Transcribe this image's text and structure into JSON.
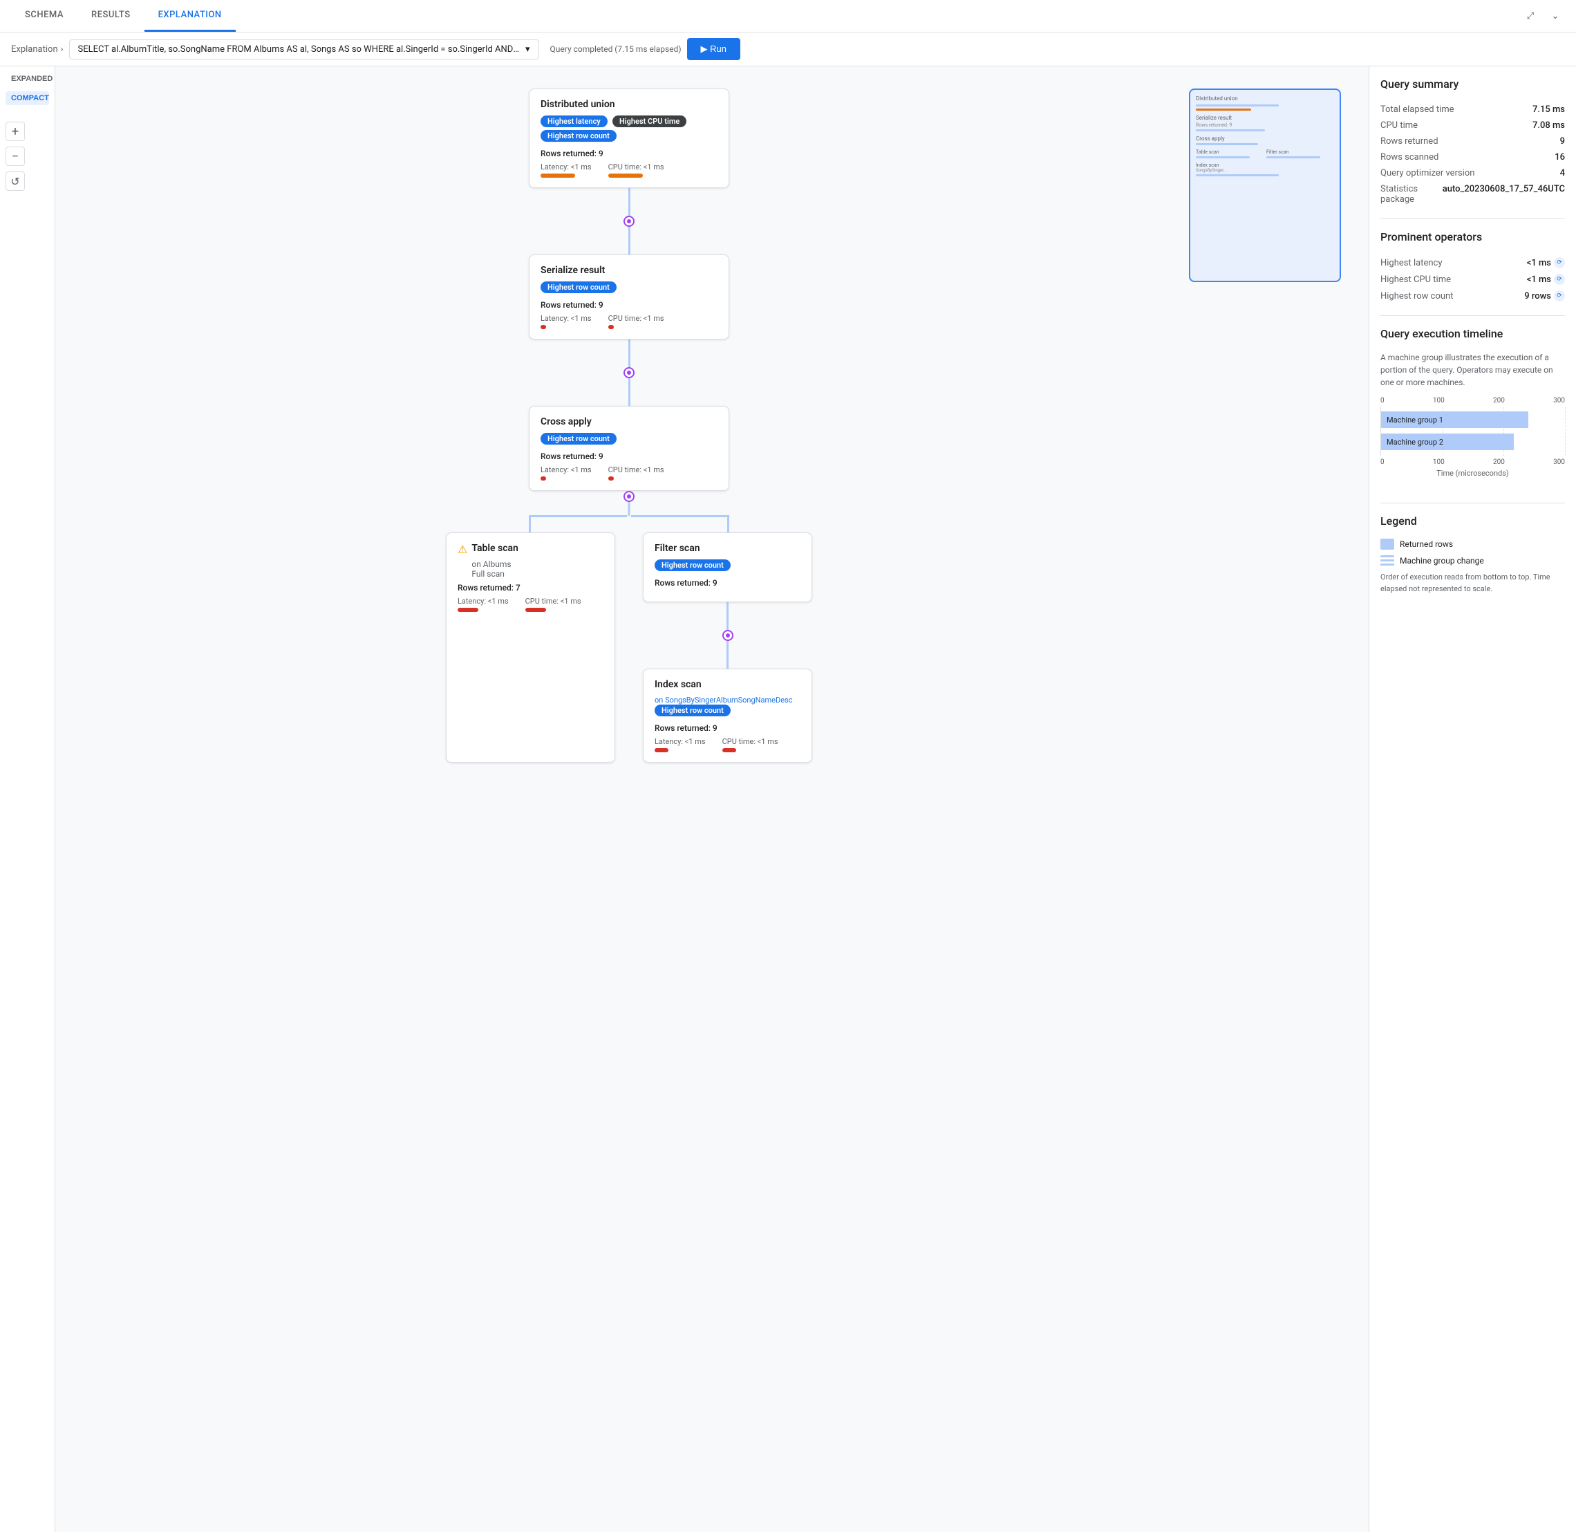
{
  "tabs": [
    {
      "id": "schema",
      "label": "SCHEMA"
    },
    {
      "id": "results",
      "label": "RESULTS"
    },
    {
      "id": "explanation",
      "label": "EXPLANATION",
      "active": true
    }
  ],
  "toolbar": {
    "breadcrumb": "Explanation",
    "query": "SELECT al.AlbumTitle, so.SongName FROM Albums AS al, Songs AS so WHERE al.SingerId = so.SingerId AND al.AlbumId = so.Alb...",
    "status": "Query completed (7.15 ms elapsed)"
  },
  "view_buttons": {
    "expanded": "EXPANDED",
    "compact": "COMPACT"
  },
  "zoom_in": "+",
  "zoom_out": "−",
  "refresh": "↺",
  "nodes": {
    "distributed_union": {
      "title": "Distributed union",
      "badges": [
        "Highest latency",
        "Highest CPU time",
        "Highest row count"
      ],
      "rows_returned": "Rows returned: 9",
      "latency": "Latency: <1 ms",
      "cpu_time": "CPU time: <1 ms"
    },
    "serialize_result": {
      "title": "Serialize result",
      "badges": [
        "Highest row count"
      ],
      "rows_returned": "Rows returned: 9",
      "latency": "Latency: <1 ms",
      "cpu_time": "CPU time: <1 ms"
    },
    "cross_apply": {
      "title": "Cross apply",
      "badges": [
        "Highest row count"
      ],
      "rows_returned": "Rows returned: 9",
      "latency": "Latency: <1 ms",
      "cpu_time": "CPU time: <1 ms"
    },
    "table_scan": {
      "title": "Table scan",
      "subtitle1": "on Albums",
      "subtitle2": "Full scan",
      "rows_returned": "Rows returned: 7",
      "latency": "Latency: <1 ms",
      "cpu_time": "CPU time: <1 ms",
      "has_warning": true
    },
    "filter_scan": {
      "title": "Filter scan",
      "badges": [
        "Highest row count"
      ],
      "rows_returned": "Rows returned: 9",
      "latency": "",
      "cpu_time": ""
    },
    "index_scan": {
      "title": "Index scan",
      "subtitle1": "on SongsBySingerAlbumSongNameDesc",
      "badges": [
        "Highest row count"
      ],
      "rows_returned": "Rows returned: 9",
      "latency": "Latency: <1 ms",
      "cpu_time": "CPU time: <1 ms"
    }
  },
  "query_summary": {
    "title": "Query summary",
    "stats": [
      {
        "label": "Total elapsed time",
        "value": "7.15 ms"
      },
      {
        "label": "CPU time",
        "value": "7.08 ms"
      },
      {
        "label": "Rows returned",
        "value": "9"
      },
      {
        "label": "Rows scanned",
        "value": "16"
      },
      {
        "label": "Query optimizer version",
        "value": "4"
      },
      {
        "label": "Statistics package",
        "value": "auto_20230608_17_57_46UTC"
      }
    ]
  },
  "prominent_operators": {
    "title": "Prominent operators",
    "items": [
      {
        "label": "Highest latency",
        "value": "<1 ms"
      },
      {
        "label": "Highest CPU time",
        "value": "<1 ms"
      },
      {
        "label": "Highest row count",
        "value": "9 rows"
      }
    ]
  },
  "execution_timeline": {
    "title": "Query execution timeline",
    "description": "A machine group illustrates the execution of a portion of the query.\nOperators may execute on one or more machines.",
    "axis_top": [
      "0",
      "100",
      "200",
      "300"
    ],
    "bars": [
      {
        "label": "Machine group 1",
        "width_pct": 80
      },
      {
        "label": "Machine group 2",
        "width_pct": 72
      }
    ],
    "axis_bottom": [
      "0",
      "100",
      "200",
      "300"
    ],
    "x_label": "Time (microseconds)"
  },
  "legend": {
    "title": "Legend",
    "items": [
      {
        "type": "solid",
        "label": "Returned rows"
      },
      {
        "type": "striped",
        "label": "Machine group change"
      }
    ],
    "note": "Order of execution reads from bottom to top.\nTime elapsed not represented to scale."
  },
  "machine_group_labels": {
    "label1": "Machine group",
    "label2": "Machine group"
  }
}
